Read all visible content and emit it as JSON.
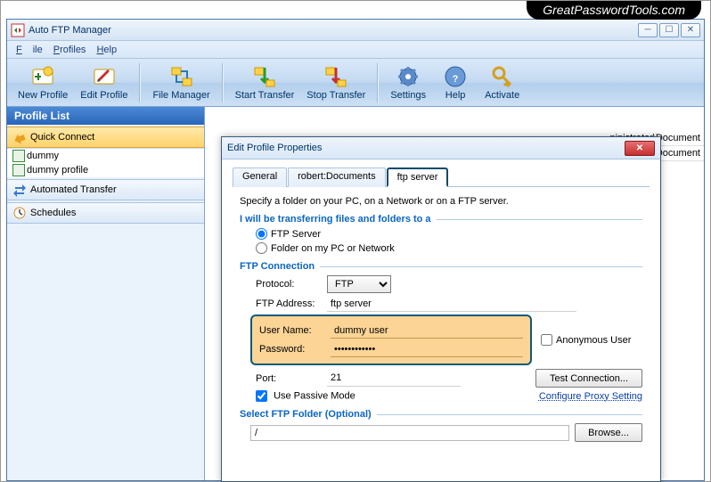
{
  "watermark": "GreatPasswordTools.com",
  "window": {
    "title": "Auto FTP Manager"
  },
  "menu": {
    "file": "File",
    "profiles": "Profiles",
    "help": "Help"
  },
  "toolbar": {
    "new_profile": "New Profile",
    "edit_profile": "Edit Profile",
    "file_manager": "File Manager",
    "start_transfer": "Start Transfer",
    "stop_transfer": "Stop Transfer",
    "settings": "Settings",
    "help": "Help",
    "activate": "Activate"
  },
  "left_panel": {
    "header": "Profile List",
    "quick_connect": "Quick Connect",
    "items": [
      "dummy",
      "dummy profile"
    ],
    "automated": "Automated Transfer",
    "schedules": "Schedules"
  },
  "right_panel": {
    "rows": [
      "ninistrator\\Document",
      "ninistrator\\Document"
    ]
  },
  "dialog": {
    "title": "Edit Profile Properties",
    "tabs": {
      "general": "General",
      "robert": "robert:Documents",
      "ftp": "ftp server"
    },
    "intro": "Specify a folder on your PC, on a Network or on a  FTP server.",
    "sect1": "I will be transferring files and folders to a",
    "r_ftp": "FTP Server",
    "r_folder": "Folder on my PC or Network",
    "sect2": "FTP Connection",
    "protocol_lbl": "Protocol:",
    "protocol_val": "FTP",
    "addr_lbl": "FTP Address:",
    "addr_val": "ftp server",
    "user_lbl": "User Name:",
    "user_val": "dummy user",
    "pass_lbl": "Password:",
    "pass_val": "************",
    "anon": "Anonymous User",
    "port_lbl": "Port:",
    "port_val": "21",
    "test": "Test Connection...",
    "passive": "Use Passive Mode",
    "proxy": "Configure Proxy Setting",
    "sect3": "Select FTP Folder (Optional)",
    "folder_val": "/",
    "browse": "Browse..."
  }
}
